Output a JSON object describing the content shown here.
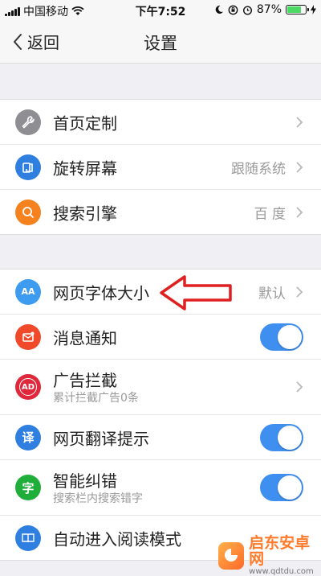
{
  "status": {
    "carrier": "中国移动",
    "time": "下午7:52",
    "battery": "87%",
    "battery_level": 0.87,
    "battery_color": "#4cd964"
  },
  "nav": {
    "back_label": "返回",
    "title": "设置"
  },
  "group1": [
    {
      "title": "首页定制",
      "icon": "wrench-icon",
      "icon_color": "#8e8e93",
      "value": "",
      "control": "chevron"
    },
    {
      "title": "旋转屏幕",
      "icon": "rotate-screen-icon",
      "icon_color": "#2f7fe0",
      "value": "跟随系统",
      "control": "chevron"
    },
    {
      "title": "搜索引擎",
      "icon": "search-icon",
      "icon_color": "#f5821f",
      "value": "百 度",
      "control": "chevron"
    }
  ],
  "group2": [
    {
      "title": "网页字体大小",
      "icon": "font-size-icon",
      "icon_glyph": "AA",
      "icon_color": "#3d9cf0",
      "value": "默认",
      "control": "chevron"
    },
    {
      "title": "消息通知",
      "icon": "message-notification-icon",
      "icon_color": "#f14a2a",
      "value": "",
      "control": "toggle",
      "on": true
    },
    {
      "title": "广告拦截",
      "subtitle": "累计拦截广告0条",
      "icon": "ad-block-icon",
      "icon_glyph": "AD",
      "icon_color": "#e0283c",
      "control": "chevron"
    },
    {
      "title": "网页翻译提示",
      "icon": "translate-icon",
      "icon_glyph": "译",
      "icon_color": "#2f7fe0",
      "control": "toggle",
      "on": true
    },
    {
      "title": "智能纠错",
      "subtitle": "搜索栏内搜索错字",
      "icon": "spell-check-icon",
      "icon_glyph": "字",
      "icon_color": "#1fae3a",
      "control": "toggle",
      "on": true
    },
    {
      "title": "自动进入阅读模式",
      "icon": "reading-mode-icon",
      "icon_color": "#2f7fe0",
      "control": "none"
    }
  ],
  "colors": {
    "toggle_on": "#3f8ff0",
    "annotation_arrow": "#e02020",
    "page_bg": "#efeff4"
  },
  "watermark": {
    "name": "启东安卓网",
    "url": "www.qdtdu.com"
  }
}
